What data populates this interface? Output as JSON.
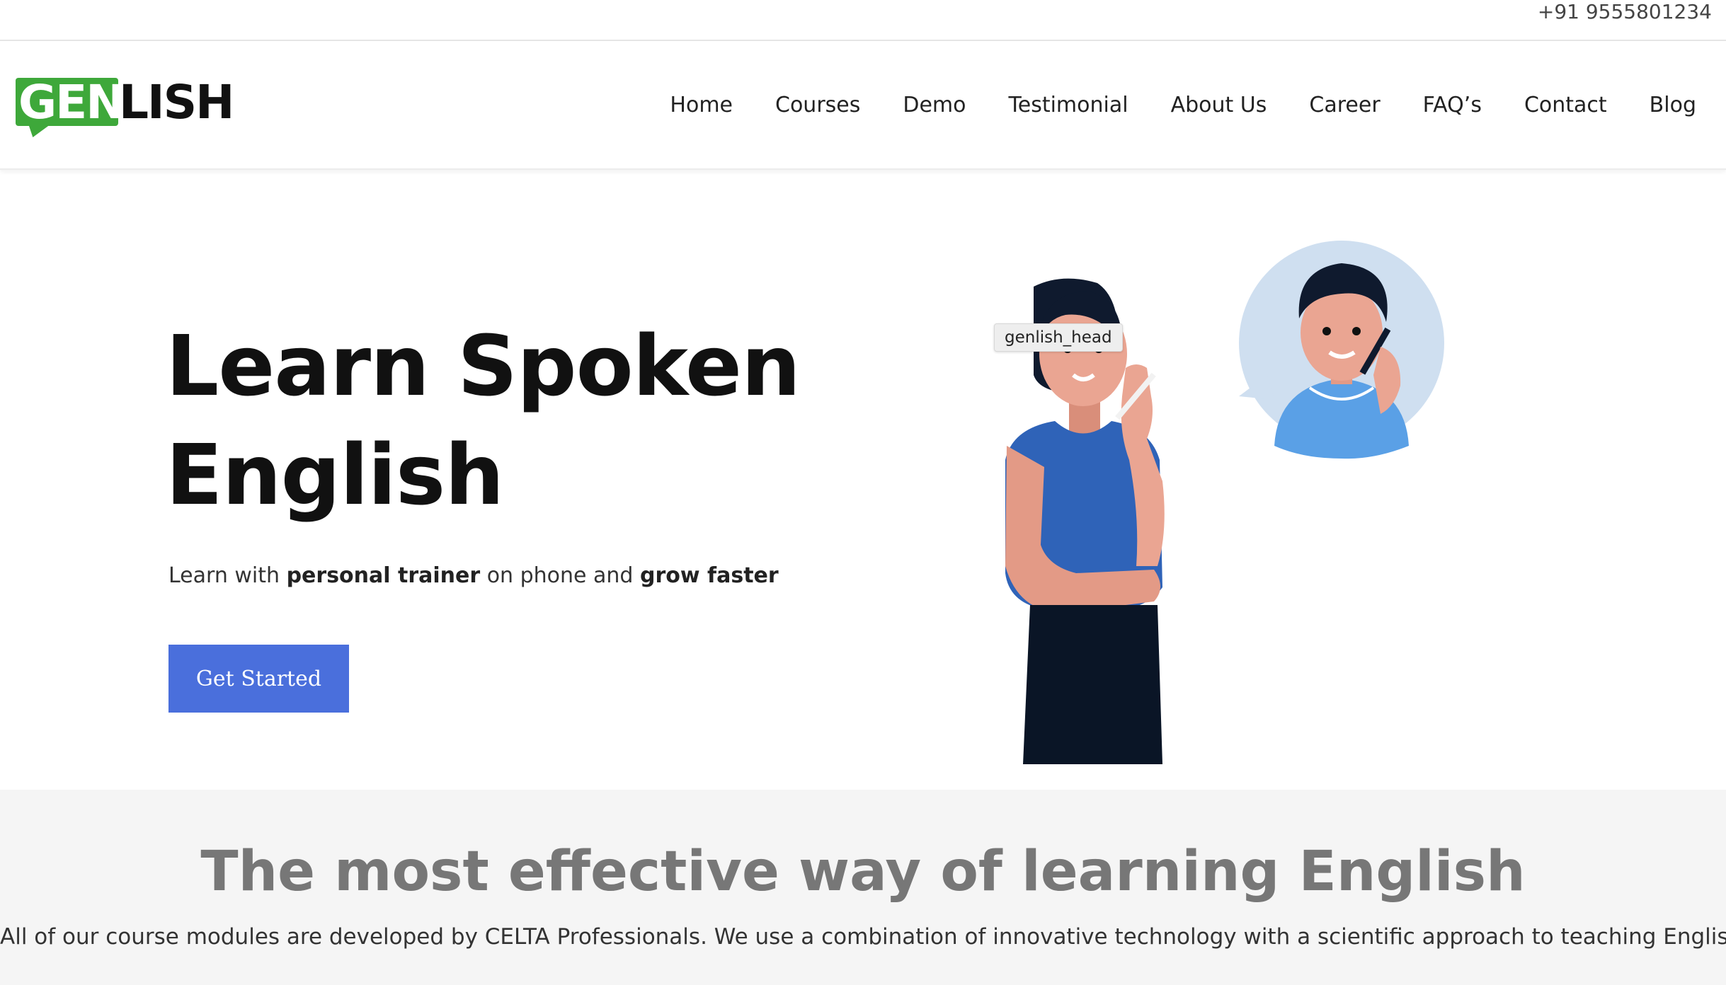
{
  "topbar": {
    "phone": "+91 9555801234"
  },
  "logo": {
    "part1": "GEN",
    "part2": "LISH"
  },
  "nav": {
    "items": [
      "Home",
      "Courses",
      "Demo",
      "Testimonial",
      "About Us",
      "Career",
      "FAQ’s",
      "Contact",
      "Blog"
    ]
  },
  "hero": {
    "title_line1": "Learn Spoken",
    "title_line2": "English",
    "sub_1": "Learn with ",
    "sub_bold_1": "personal trainer",
    "sub_2": " on phone and ",
    "sub_bold_2": "grow faster",
    "button_label": "Get Started",
    "image_tooltip": "genlish_head"
  },
  "section2": {
    "heading": "The most effective way of learning English",
    "text": "All of our course modules are developed by CELTA Professionals. We use a combination of innovative technology with a scientific approach to teaching English."
  },
  "colors": {
    "brand_green": "#3ea83a",
    "button_blue": "#4a6fdc",
    "shirt_blue": "#2f63b8",
    "bubble": "#cfdff0"
  }
}
